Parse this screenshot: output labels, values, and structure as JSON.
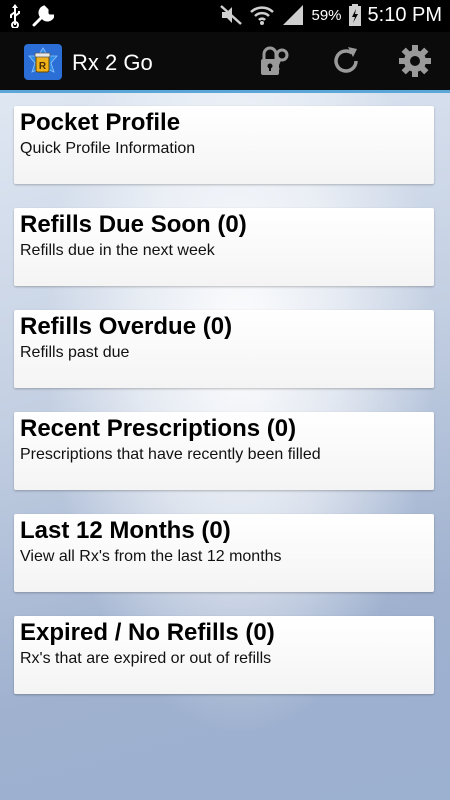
{
  "status_bar": {
    "battery_percent": "59%",
    "time": "5:10 PM",
    "icons": [
      "usb-icon",
      "wrench-icon",
      "mute-icon",
      "wifi-icon",
      "signal-icon",
      "battery-charging-icon"
    ]
  },
  "action_bar": {
    "title": "Rx 2 Go",
    "app_icon": "rx2go-logo-icon",
    "actions": [
      "lock-key-icon",
      "refresh-icon",
      "settings-gear-icon"
    ],
    "accent_color": "#5aa6d8"
  },
  "menu": {
    "items": [
      {
        "title": "Pocket Profile",
        "subtitle": "Quick Profile Information"
      },
      {
        "title": "Refills Due Soon (0)",
        "subtitle": "Refills due in the next week"
      },
      {
        "title": "Refills Overdue (0)",
        "subtitle": "Refills past due"
      },
      {
        "title": "Recent Prescriptions (0)",
        "subtitle": "Prescriptions that have recently been filled"
      },
      {
        "title": "Last 12 Months (0)",
        "subtitle": "View all Rx's from the last 12 months"
      },
      {
        "title": "Expired / No Refills (0)",
        "subtitle": "Rx's that are expired or out of refills"
      }
    ]
  }
}
